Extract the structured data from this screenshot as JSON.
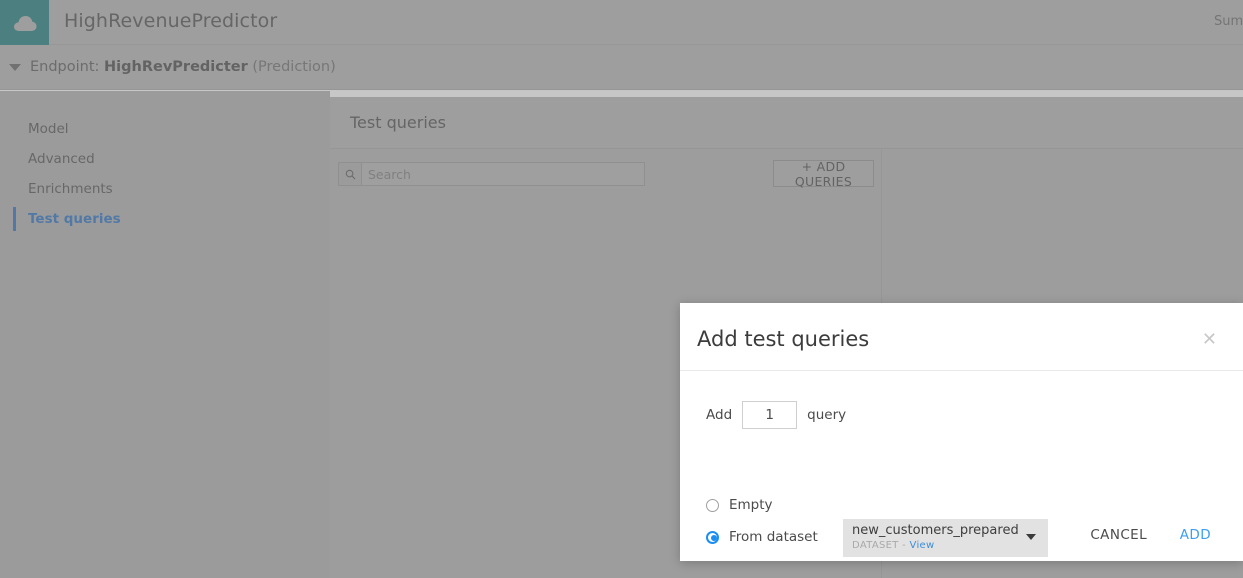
{
  "topbar": {
    "app_title": "HighRevenuePredictor",
    "logo_icon": "cloud-icon",
    "right_label": "Sum"
  },
  "breadcrumb": {
    "caret_icon": "caret-down-icon",
    "prefix": "Endpoint: ",
    "name": "HighRevPredicter",
    "suffix": " (Prediction)"
  },
  "sidebar": {
    "items": [
      {
        "label": "Model",
        "active": false
      },
      {
        "label": "Advanced",
        "active": false
      },
      {
        "label": "Enrichments",
        "active": false
      },
      {
        "label": "Test queries",
        "active": true
      }
    ]
  },
  "main": {
    "panel_title": "Test queries",
    "search": {
      "icon": "search-icon",
      "value": "",
      "placeholder": "Search"
    },
    "add_queries_label": "+ ADD QUERIES"
  },
  "modal": {
    "title": "Add test queries",
    "close_icon": "close-icon",
    "count_prefix": "Add",
    "count_value": "1",
    "count_suffix": "query",
    "options": {
      "empty_label": "Empty",
      "empty_selected": false,
      "dataset_label": "From dataset",
      "dataset_selected": true
    },
    "dataset": {
      "name": "new_customers_prepared",
      "kind": "DATASET",
      "separator": "-",
      "view_link": "View",
      "arrow_icon": "chevron-down-icon"
    },
    "cancel_label": "CANCEL",
    "add_label": "ADD"
  },
  "colors": {
    "brand_teal": "#207f7e",
    "accent_blue": "#2a72c4",
    "link_blue": "#3d9ef0",
    "chrome_gray": "#b4b4b4"
  }
}
